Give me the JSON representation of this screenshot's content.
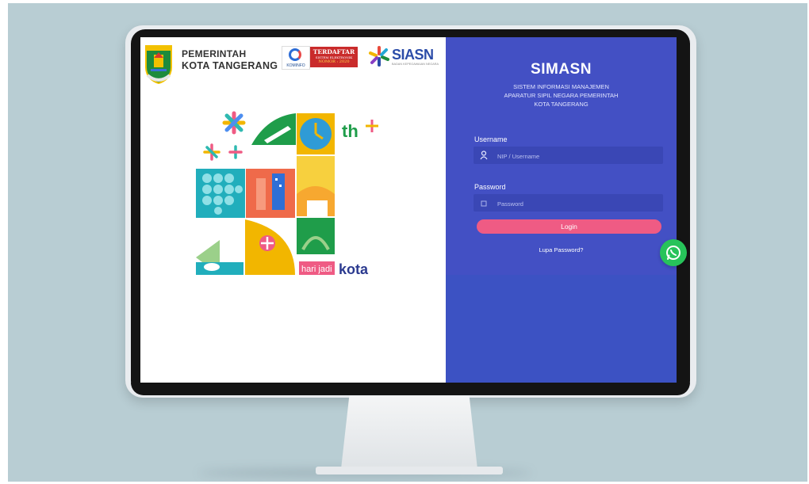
{
  "header": {
    "gov_line1": "PEMERINTAH",
    "gov_line2": "KOTA TANGERANG",
    "badge_kominfo": "KOMINFO",
    "badge_terdaftar": "TERDAFTAR",
    "badge_sistem": "SISTEM ELEKTRONIK",
    "badge_nomor": "NOMOR : 2020",
    "siasn_logo": "SIASN",
    "siasn_sub": "BADAN KEPEGAWAIAN NEGARA"
  },
  "art": {
    "th": "th",
    "hari_jadi": "hari jadi",
    "kota": "kota"
  },
  "login_panel": {
    "title": "SIMASN",
    "subtitle_line1": "SISTEM INFORMASI MANAJEMEN",
    "subtitle_line2": "APARATUR SIPIL NEGARA PEMERINTAH",
    "subtitle_line3": "KOTA TANGERANG",
    "username_label": "Username",
    "username_placeholder": "NIP / Username",
    "password_label": "Password",
    "password_placeholder": "Password",
    "login_button": "Login",
    "forgot_link": "Lupa Password?"
  },
  "colors": {
    "panel_bg": "#3c52c3",
    "login_button": "#ef5b84",
    "whatsapp": "#27c35a",
    "background": "#b8cdd3"
  },
  "icons": {
    "username": "user-icon",
    "password": "lock-icon",
    "chat": "whatsapp-icon"
  }
}
